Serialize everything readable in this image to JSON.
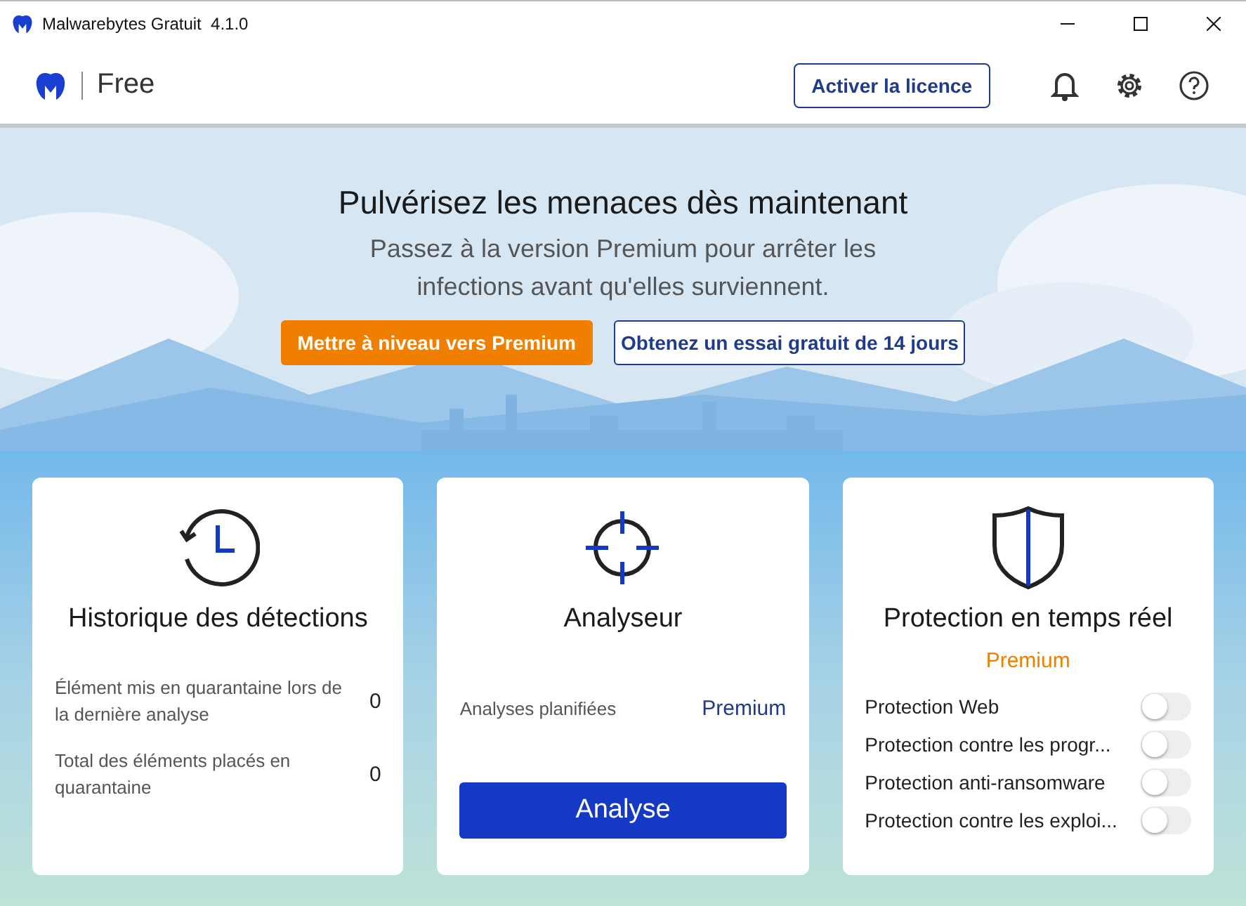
{
  "window": {
    "title": "Malwarebytes Gratuit  4.1.0"
  },
  "header": {
    "edition": "Free",
    "activate_button": "Activer la licence"
  },
  "banner": {
    "title": "Pulvérisez les menaces dès maintenant",
    "subtitle": "Passez à la version Premium pour arrêter les infections avant qu'elles surviennent.",
    "upgrade_button": "Mettre à niveau vers Premium",
    "trial_button": "Obtenez un essai gratuit de 14 jours"
  },
  "detections": {
    "title": "Historique des détections",
    "stats": [
      {
        "label": "Élément mis en quarantaine lors de la dernière analyse",
        "value": "0"
      },
      {
        "label": "Total des éléments placés en quarantaine",
        "value": "0"
      }
    ]
  },
  "scanner": {
    "title": "Analyseur",
    "scheduled_label": "Analyses planifiées",
    "scheduled_link": "Premium",
    "scan_button": "Analyse"
  },
  "realtime": {
    "title": "Protection en temps réel",
    "badge": "Premium",
    "items": [
      {
        "label": "Protection Web",
        "on": false
      },
      {
        "label": "Protection contre les progr...",
        "on": false
      },
      {
        "label": "Protection anti-ransomware",
        "on": false
      },
      {
        "label": "Protection contre les exploi...",
        "on": false
      }
    ]
  }
}
